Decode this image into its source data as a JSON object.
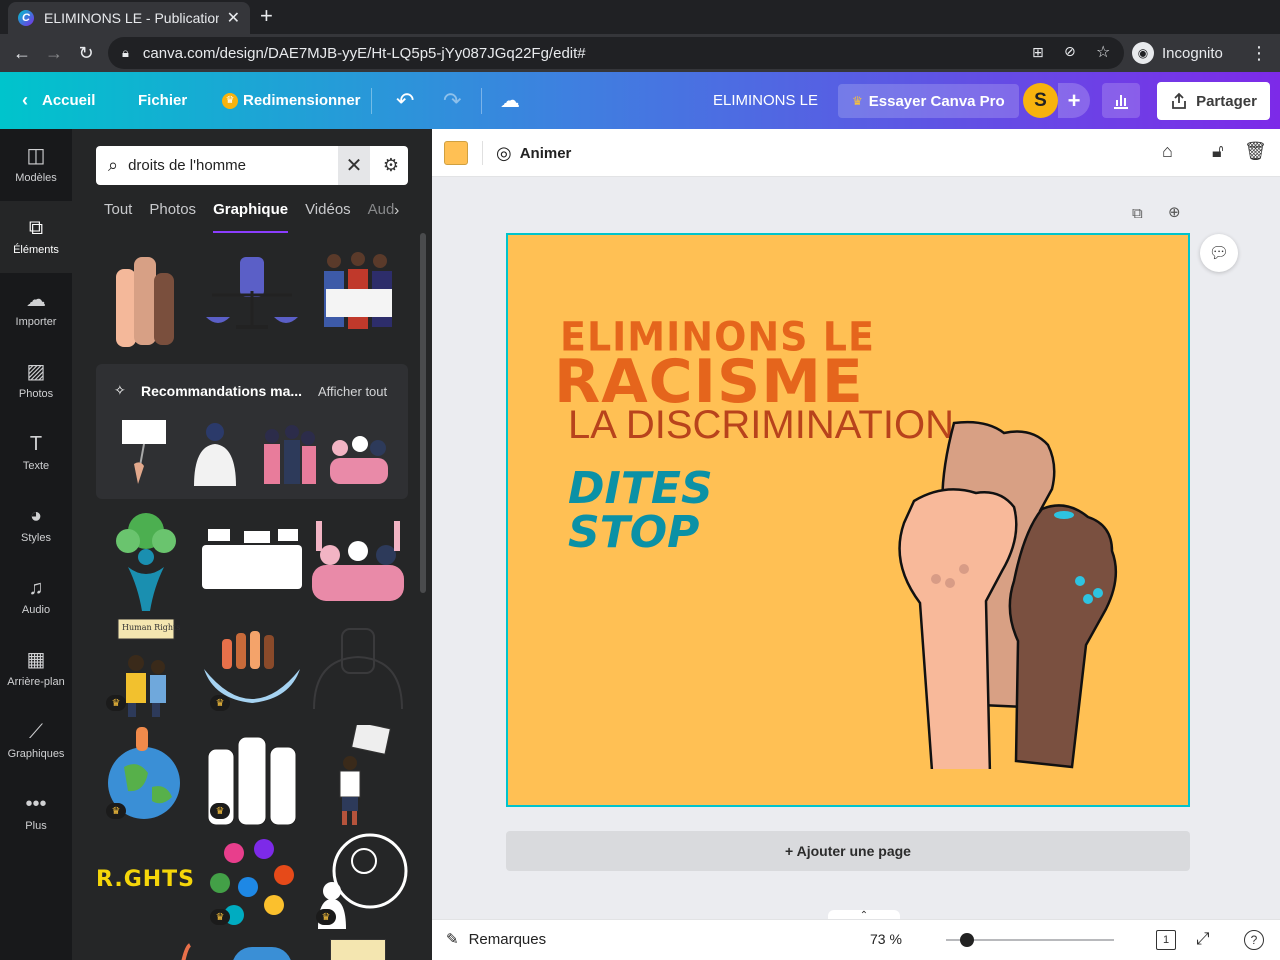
{
  "browser": {
    "tab_title": "ELIMINONS LE - Publication",
    "tab_favicon": "C",
    "url": "canva.com/design/DAE7MJB-yyE/Ht-LQ5p5-jYy087JGq22Fg/edit#",
    "profile_label": "Incognito"
  },
  "header": {
    "home": "Accueil",
    "file": "Fichier",
    "resize": "Redimensionner",
    "doc_title": "ELIMINONS LE",
    "try_pro": "Essayer Canva Pro",
    "avatar_letter": "S",
    "share": "Partager"
  },
  "rail": {
    "items": [
      {
        "label": "Modèles",
        "icon": "templates-icon"
      },
      {
        "label": "Éléments",
        "icon": "elements-icon"
      },
      {
        "label": "Importer",
        "icon": "upload-icon"
      },
      {
        "label": "Photos",
        "icon": "photos-icon"
      },
      {
        "label": "Texte",
        "icon": "text-icon"
      },
      {
        "label": "Styles",
        "icon": "palette-icon"
      },
      {
        "label": "Audio",
        "icon": "audio-icon"
      },
      {
        "label": "Arrière-plan",
        "icon": "background-icon"
      },
      {
        "label": "Graphiques",
        "icon": "charts-icon"
      },
      {
        "label": "Plus",
        "icon": "more-icon"
      }
    ]
  },
  "panel": {
    "search_value": "droits de l'homme",
    "tabs": [
      "Tout",
      "Photos",
      "Graphique",
      "Vidéos",
      "Aud"
    ],
    "active_tab": "Graphique",
    "reco_title": "Recommandations ma...",
    "reco_see_all": "Afficher tout",
    "rights_text": "R.GHTS",
    "human_rights_sign": "Human Rights"
  },
  "toolbar": {
    "color": "#ffc054",
    "animate": "Animer"
  },
  "design": {
    "line1": "ELIMINONS LE",
    "line2": "RACISME",
    "line3": "LA DISCRIMINATION",
    "line4a": "DITES",
    "line4b": "STOP",
    "background": "#ffc054"
  },
  "canvas": {
    "add_page": "+ Ajouter une page"
  },
  "bottom": {
    "notes": "Remarques",
    "zoom": "73 %",
    "zoom_level": 0.73,
    "page_count": "1"
  }
}
